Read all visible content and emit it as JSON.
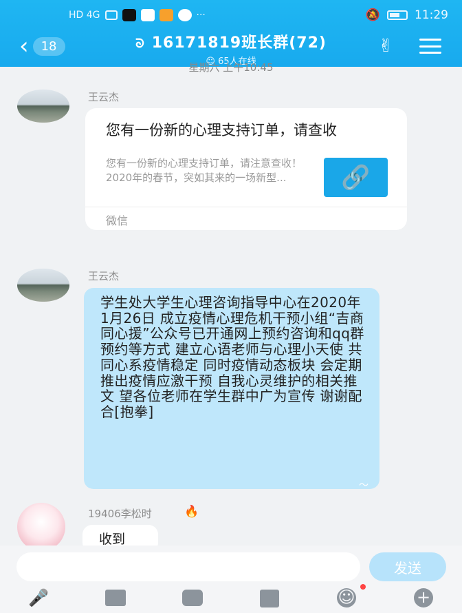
{
  "status_bar": {
    "network_left": "HD 4G",
    "more": "···",
    "time": "11:29"
  },
  "header": {
    "back_count": "18",
    "title": "16171819班长群(72)",
    "online": "65人在线"
  },
  "chat": {
    "timestamp": "星期六 上午10:45",
    "messages": [
      {
        "sender": "王云杰",
        "card": {
          "title": "您有一份新的心理支持订单，请查收",
          "description": "您有一份新的心理支持订单，请注意查收！2020年的春节，突如其来的一场新型...",
          "source": "微信"
        }
      },
      {
        "sender": "王云杰",
        "text": "学生处大学生心理咨询指导中心在2020年1月26日 成立疫情心理危机干预小组“吉商同心援”公众号已开通网上预约咨询和qq群预约等方式 建立心语老师与心理小天使 共同心系疫情稳定 同时疫情动态板块 会定期推出疫情应激干预 自我心灵维护的相关推文 望各位老师在学生群中广为宣传 谢谢配合[抱拳]"
      },
      {
        "sender": "19406李松时",
        "text": "收到"
      }
    ]
  },
  "input": {
    "placeholder": "",
    "send_label": "发送"
  },
  "icons": {
    "back": "chevron-left-icon",
    "title_icon": "group-icon",
    "header_right": [
      "hand-sign-icon",
      "menu-icon"
    ],
    "card_thumb": "link-icon",
    "toolbar": [
      "microphone-icon",
      "image-icon",
      "camera-icon",
      "red-packet-icon",
      "emoji-icon",
      "plus-icon"
    ]
  },
  "colors": {
    "header": "#1fb6f2",
    "bubble": "#bfe7fb",
    "send_button": "#b7e3fb",
    "link_thumb": "#1aa7e8"
  }
}
